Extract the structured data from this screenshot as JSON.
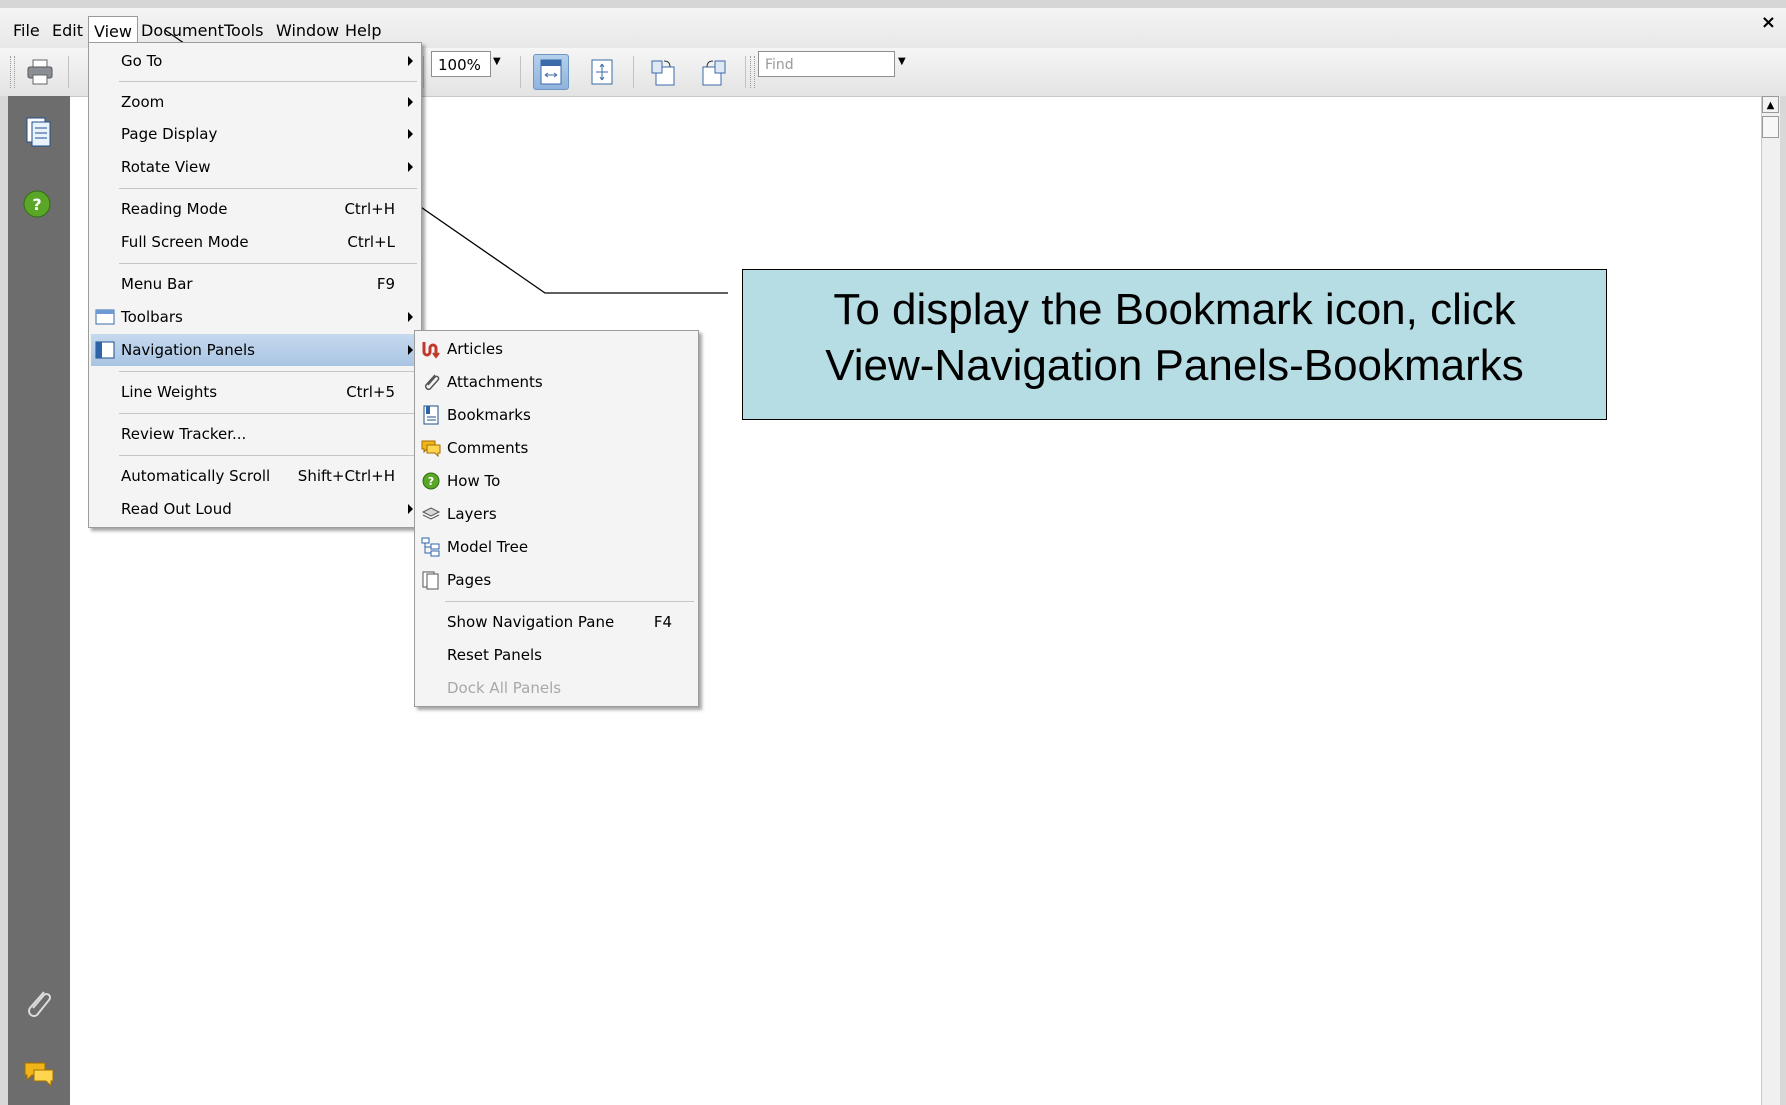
{
  "menubar": {
    "items": [
      "File",
      "Edit",
      "View",
      "Document",
      "Tools",
      "Window",
      "Help"
    ],
    "close_glyph": "×"
  },
  "toolbar": {
    "zoom_value": "100%",
    "find_placeholder": "Find"
  },
  "view_menu": [
    {
      "label": "Go To",
      "shortcut": "",
      "submenu": true
    },
    {
      "label": "Zoom",
      "shortcut": "",
      "submenu": true
    },
    {
      "label": "Page Display",
      "shortcut": "",
      "submenu": true
    },
    {
      "label": "Rotate View",
      "shortcut": "",
      "submenu": true
    },
    {
      "label": "Reading Mode",
      "shortcut": "Ctrl+H",
      "submenu": false
    },
    {
      "label": "Full Screen Mode",
      "shortcut": "Ctrl+L",
      "submenu": false
    },
    {
      "label": "Menu Bar",
      "shortcut": "F9",
      "submenu": false
    },
    {
      "label": "Toolbars",
      "shortcut": "",
      "submenu": true
    },
    {
      "label": "Navigation Panels",
      "shortcut": "",
      "submenu": true,
      "highlighted": true
    },
    {
      "label": "Line Weights",
      "shortcut": "Ctrl+5",
      "submenu": false
    },
    {
      "label": "Review Tracker...",
      "shortcut": "",
      "submenu": false
    },
    {
      "label": "Automatically Scroll",
      "shortcut": "Shift+Ctrl+H",
      "submenu": false
    },
    {
      "label": "Read Out Loud",
      "shortcut": "",
      "submenu": true
    }
  ],
  "nav_panels_menu": [
    {
      "label": "Articles",
      "icon": "articles-icon"
    },
    {
      "label": "Attachments",
      "icon": "paperclip-icon"
    },
    {
      "label": "Bookmarks",
      "icon": "bookmark-icon"
    },
    {
      "label": "Comments",
      "icon": "comment-icon"
    },
    {
      "label": "How To",
      "icon": "help-icon"
    },
    {
      "label": "Layers",
      "icon": "layers-icon"
    },
    {
      "label": "Model Tree",
      "icon": "model-tree-icon"
    },
    {
      "label": "Pages",
      "icon": "pages-icon"
    },
    {
      "label": "Show Navigation Pane",
      "shortcut": "F4"
    },
    {
      "label": "Reset Panels",
      "shortcut": ""
    },
    {
      "label": "Dock All Panels",
      "shortcut": "",
      "disabled": true
    }
  ],
  "callout": {
    "line1": "To display the Bookmark icon, click",
    "line2": "View-Navigation Panels-Bookmarks"
  },
  "colors": {
    "callout_bg": "#b7dde4",
    "highlight": "#a9c5e4",
    "side_panel": "#6d6d6d"
  }
}
